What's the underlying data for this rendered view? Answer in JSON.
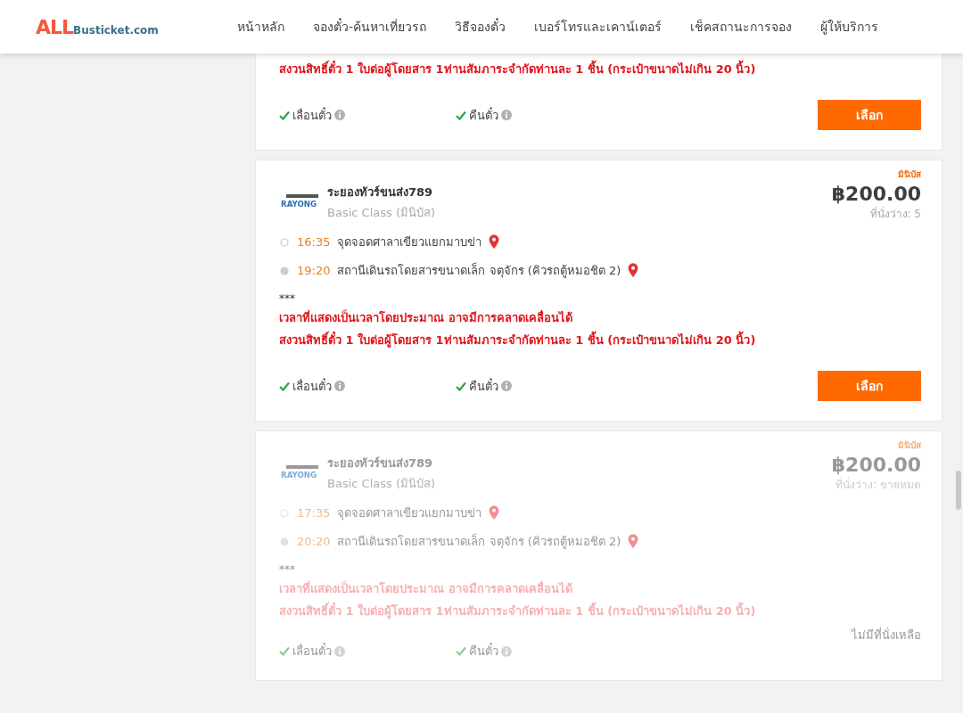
{
  "header": {
    "logo": {
      "mark": "ALL",
      "site": "Busticket.com"
    },
    "nav": [
      {
        "label": "หน้าหลัก"
      },
      {
        "label": "จองตั๋ว-ค้นหาเที่ยวรถ"
      },
      {
        "label": "วิธีจองตั๋ว"
      },
      {
        "label": "เบอร์โทรและเคาน์เตอร์"
      },
      {
        "label": "เช็คสถานะการจอง"
      },
      {
        "label": "ผู้ให้บริการ"
      }
    ]
  },
  "trips": [
    {
      "sold_out": false,
      "notes": [
        {
          "kind": "warning",
          "text": "สงวนสิทธิ์ตั๋ว 1 ใบต่อผู้โดยสาร 1ท่านสัมภาระจำกัดท่านละ 1 ชิ้น (กระเป๋าขนาดไม่เกิน 20 นิ้ว)"
        }
      ],
      "features": [
        {
          "label": "เลื่อนตั๋ว",
          "available": true
        },
        {
          "label": "คืนตั๋ว",
          "available": true
        }
      ],
      "action": {
        "kind": "button",
        "label": "เลือก"
      }
    },
    {
      "sold_out": false,
      "badge": "มินิบัส",
      "operator": {
        "logo_text": "RAYONG",
        "name": "ระยองทัวร์ขนส่ง789",
        "class": "Basic Class (มินิบัส)"
      },
      "price": "฿200.00",
      "seats": "ที่นั่งว่าง: 5",
      "stops": [
        {
          "kind": "depart",
          "time": "16:35",
          "place": "จุดจอดศาลาเขียวแยกมาบข่า"
        },
        {
          "kind": "arrive",
          "time": "19:20",
          "place": "สถานีเดินรถโดยสารขนาดเล็ก จตุจักร (คิวรถตู้หมอชิต 2)"
        }
      ],
      "notes": [
        {
          "kind": "plain",
          "text": "***"
        },
        {
          "kind": "warning",
          "text": "เวลาที่แสดงเป็นเวลาโดยประมาณ อาจมีการคลาดเคลื่อนได้"
        },
        {
          "kind": "warning",
          "text": "สงวนสิทธิ์ตั๋ว 1 ใบต่อผู้โดยสาร 1ท่านสัมภาระจำกัดท่านละ 1 ชิ้น (กระเป๋าขนาดไม่เกิน 20 นิ้ว)"
        }
      ],
      "features": [
        {
          "label": "เลื่อนตั๋ว",
          "available": true
        },
        {
          "label": "คืนตั๋ว",
          "available": true
        }
      ],
      "action": {
        "kind": "button",
        "label": "เลือก"
      }
    },
    {
      "sold_out": true,
      "badge": "มินิบัส",
      "operator": {
        "logo_text": "RAYONG",
        "name": "ระยองทัวร์ขนส่ง789",
        "class": "Basic Class (มินิบัส)"
      },
      "price": "฿200.00",
      "seats": "ที่นั่งว่าง: ขายหมด",
      "stops": [
        {
          "kind": "depart",
          "time": "17:35",
          "place": "จุดจอดศาลาเขียวแยกมาบข่า"
        },
        {
          "kind": "arrive",
          "time": "20:20",
          "place": "สถานีเดินรถโดยสารขนาดเล็ก จตุจักร (คิวรถตู้หมอชิต 2)"
        }
      ],
      "notes": [
        {
          "kind": "plain",
          "text": "***"
        },
        {
          "kind": "warning",
          "text": "เวลาที่แสดงเป็นเวลาโดยประมาณ อาจมีการคลาดเคลื่อนได้"
        },
        {
          "kind": "warning",
          "text": "สงวนสิทธิ์ตั๋ว 1 ใบต่อผู้โดยสาร 1ท่านสัมภาระจำกัดท่านละ 1 ชิ้น (กระเป๋าขนาดไม่เกิน 20 นิ้ว)"
        }
      ],
      "features": [
        {
          "label": "เลื่อนตั๋ว",
          "available": true
        },
        {
          "label": "คืนตั๋ว",
          "available": true
        }
      ],
      "action": {
        "kind": "notice",
        "label": "ไม่มีที่นั่งเหลือ"
      }
    }
  ]
}
